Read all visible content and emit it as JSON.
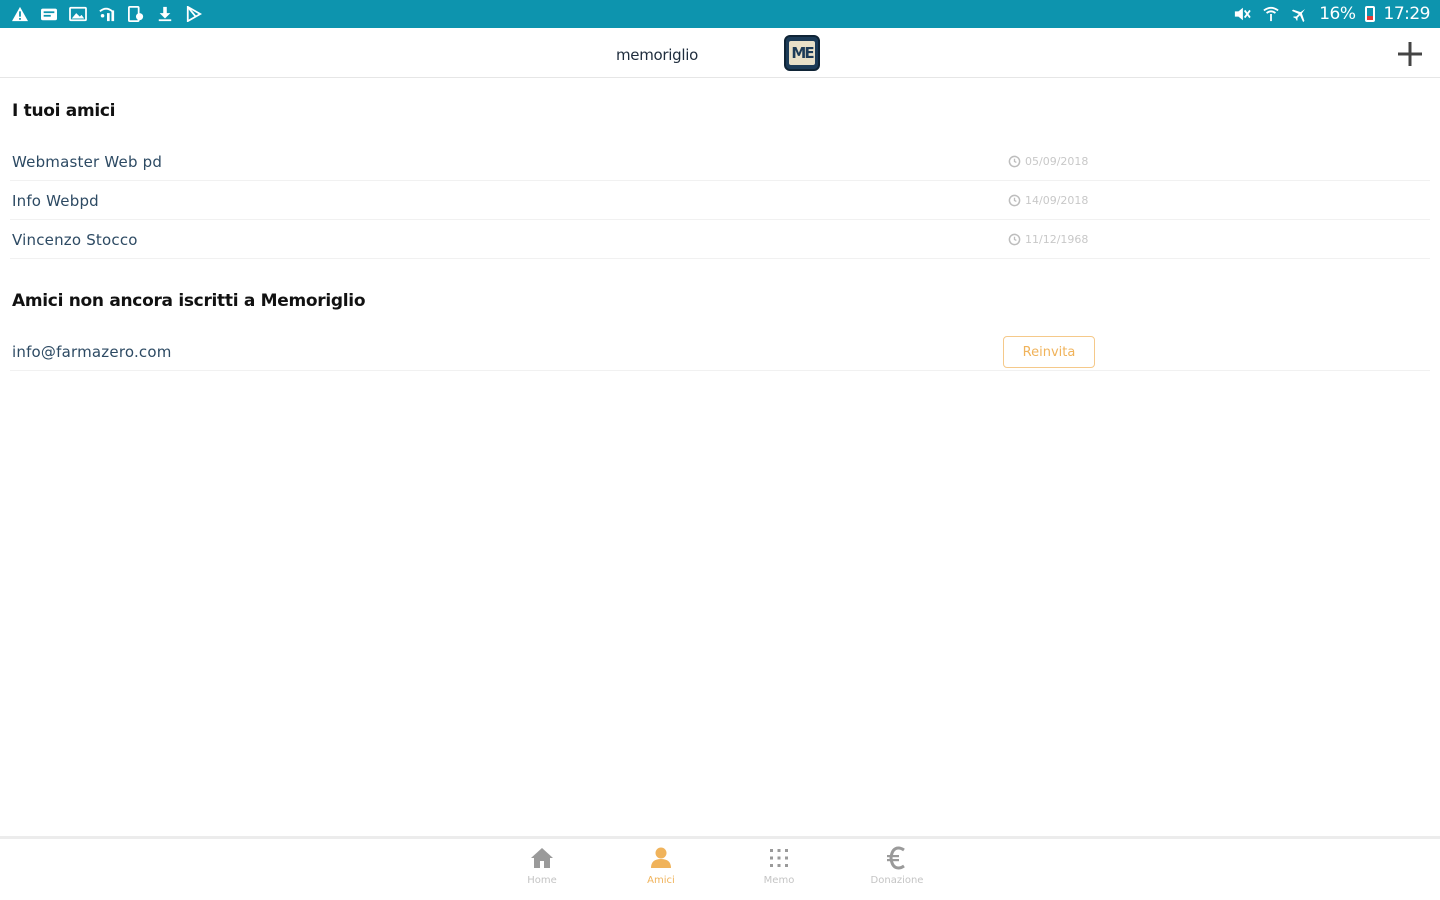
{
  "status_bar": {
    "left_icons": [
      "warning-icon",
      "message-icon",
      "image-icon",
      "wifi-signal-icon",
      "device-icon",
      "download-icon",
      "play-store-icon"
    ],
    "battery_percent": "16%",
    "time": "17:29",
    "colors": {
      "background": "#0d94ae"
    }
  },
  "header": {
    "app_title": "memoriglio",
    "logo_text": "ME"
  },
  "friends_section": {
    "title": "I tuoi amici",
    "items": [
      {
        "name": "Webmaster Web pd",
        "date": "05/09/2018"
      },
      {
        "name": "Info Webpd",
        "date": "14/09/2018"
      },
      {
        "name": "Vincenzo Stocco",
        "date": "11/12/1968"
      }
    ]
  },
  "pending_section": {
    "title": "Amici non ancora iscritti a Memoriglio",
    "items": [
      {
        "email": "info@farmazero.com",
        "action_label": "Reinvita"
      }
    ]
  },
  "bottom_nav": {
    "items": [
      {
        "label": "Home",
        "icon": "home-icon",
        "active": false
      },
      {
        "label": "Amici",
        "icon": "person-icon",
        "active": true
      },
      {
        "label": "Memo",
        "icon": "grid-icon",
        "active": false
      },
      {
        "label": "Donazione",
        "icon": "euro-icon",
        "active": false
      }
    ],
    "colors": {
      "active": "#f0b35b",
      "inactive": "#9a9a9a"
    }
  }
}
